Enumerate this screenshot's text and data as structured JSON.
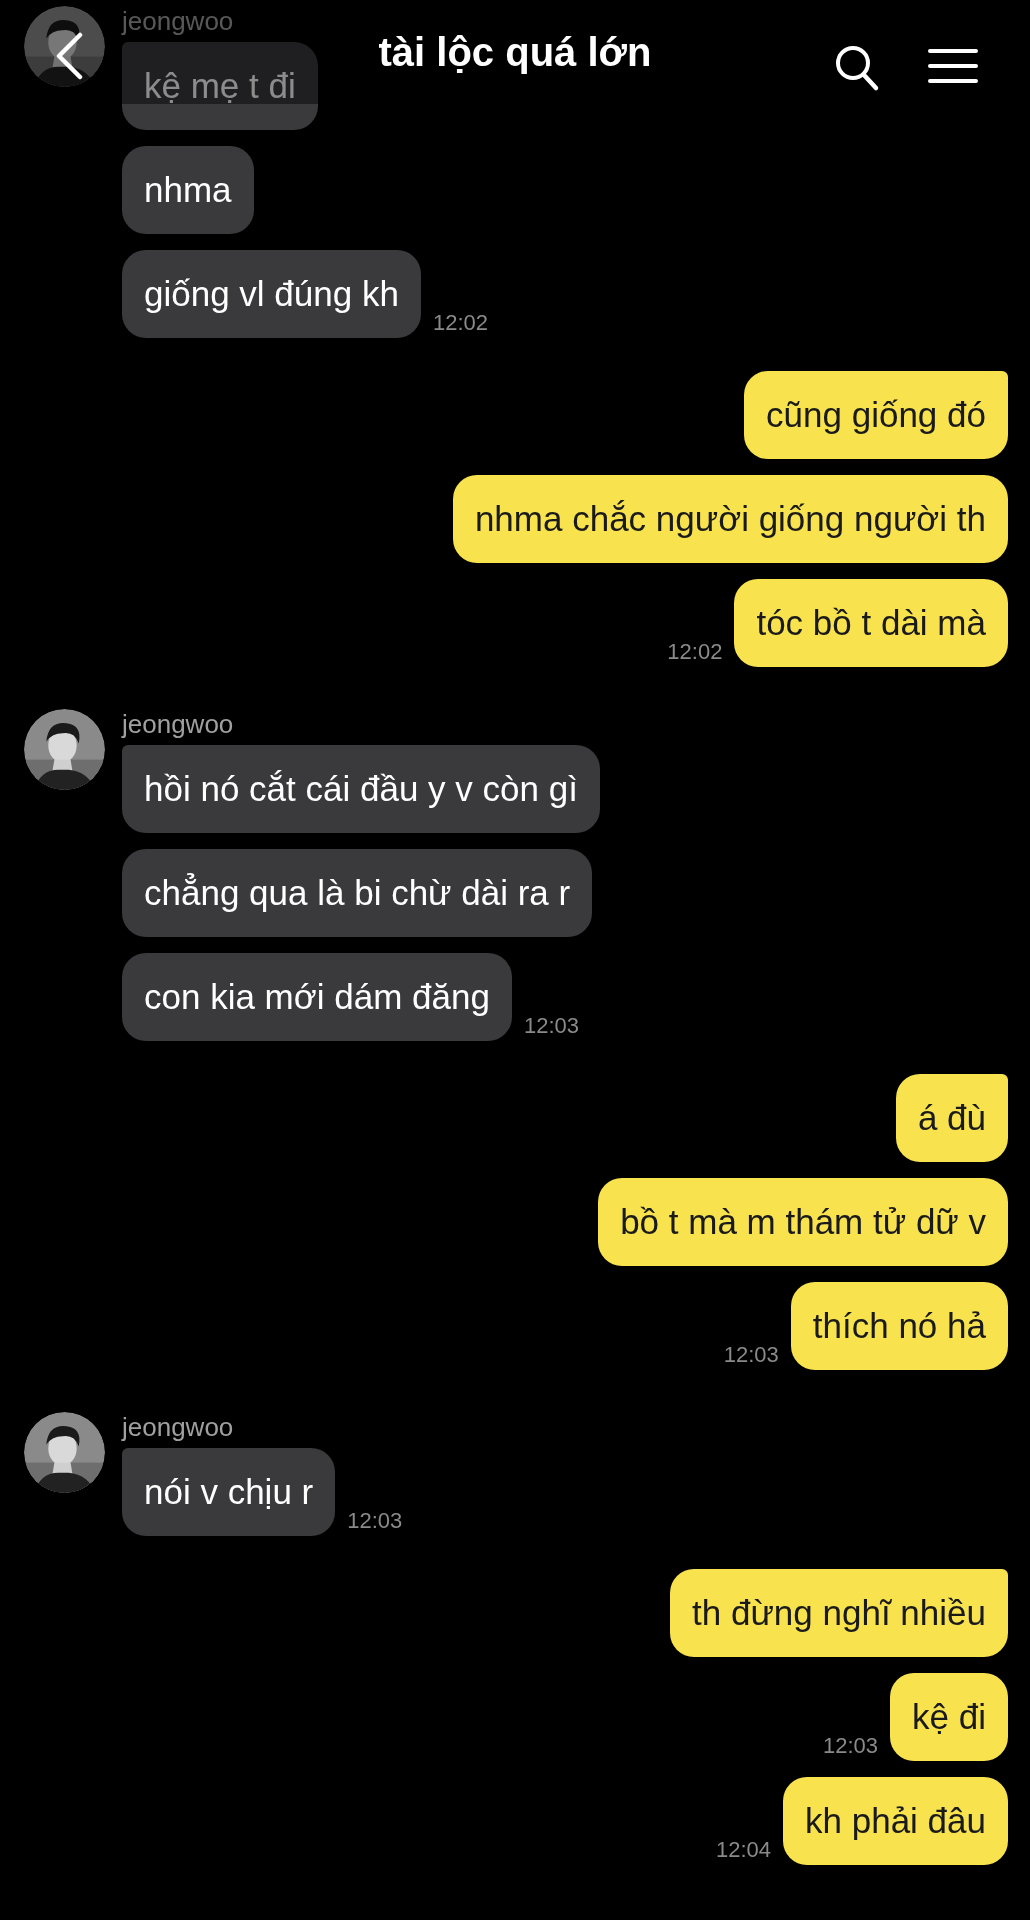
{
  "header": {
    "title": "tài lộc quá lớn"
  },
  "groups": [
    {
      "kind": "them",
      "sender": "jeongwoo",
      "messages": [
        {
          "text": "kệ mẹ t đi"
        },
        {
          "text": "nhma"
        },
        {
          "text": "giống vl đúng kh",
          "time": "12:02"
        }
      ]
    },
    {
      "kind": "me",
      "messages": [
        {
          "text": "cũng giống đó"
        },
        {
          "text": "nhma chắc người giống người th"
        },
        {
          "text": "tóc bồ t dài mà",
          "time": "12:02"
        }
      ]
    },
    {
      "kind": "them",
      "sender": "jeongwoo",
      "messages": [
        {
          "text": "hồi nó cắt cái đầu y v còn gì"
        },
        {
          "text": "chẳng qua là bi chừ dài ra r"
        },
        {
          "text": "con kia mới dám đăng",
          "time": "12:03"
        }
      ]
    },
    {
      "kind": "me",
      "messages": [
        {
          "text": "á đù"
        },
        {
          "text": "bồ t mà m thám tử dữ v"
        },
        {
          "text": "thích nó hả",
          "time": "12:03"
        }
      ]
    },
    {
      "kind": "them",
      "sender": "jeongwoo",
      "messages": [
        {
          "text": "nói v chịu r",
          "time": "12:03"
        }
      ]
    },
    {
      "kind": "me",
      "messages": [
        {
          "text": "th đừng nghĩ nhiều"
        },
        {
          "text": "kệ đi",
          "time": "12:03"
        },
        {
          "text": "kh phải đâu",
          "time": "12:04"
        }
      ]
    }
  ]
}
